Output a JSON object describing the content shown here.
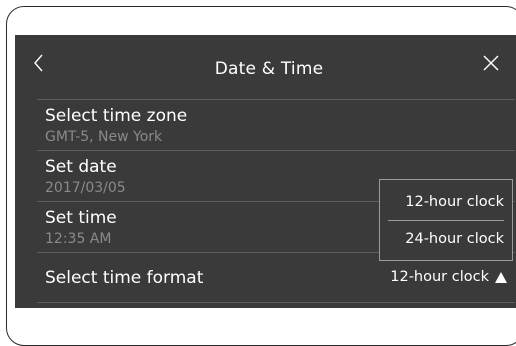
{
  "header": {
    "title": "Date & Time"
  },
  "icons": {
    "back": "chevron-left-icon",
    "close": "close-icon"
  },
  "settings": [
    {
      "label": "Select time zone",
      "value": "GMT-5, New York"
    },
    {
      "label": "Set date",
      "value": "2017/03/05"
    },
    {
      "label": "Set time",
      "value": "12:35 AM"
    }
  ],
  "time_format": {
    "label": "Select time format",
    "current": "12-hour clock",
    "options": [
      "12-hour clock",
      "24-hour clock"
    ]
  },
  "colors": {
    "screen_bg": "#3a3a3a",
    "divider": "#5e5e5e",
    "secondary_text": "#8a8a8a"
  }
}
